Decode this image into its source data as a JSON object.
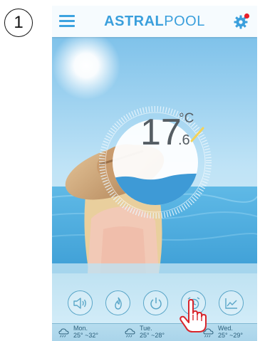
{
  "step_marker": "1",
  "app": {
    "brand_part1": "ASTRAL",
    "brand_part2": "POOL",
    "menu_icon": "hamburger-menu-icon",
    "settings_icon": "gear-icon",
    "notification_color": "#e8202a",
    "accent_color": "#3da3e0"
  },
  "temperature": {
    "integer": "17",
    "unit": "°C",
    "decimal": ".6"
  },
  "controls": [
    {
      "name": "sound-icon"
    },
    {
      "name": "flame-icon"
    },
    {
      "name": "power-icon"
    },
    {
      "name": "alarm-clock-icon"
    },
    {
      "name": "chart-icon"
    }
  ],
  "forecast": [
    {
      "day": "Mon.",
      "range": "25° ~32°",
      "icon": "cloud-sun-icon"
    },
    {
      "day": "Tue.",
      "range": "25° ~28°",
      "icon": "cloud-sun-icon"
    },
    {
      "day": "Wed.",
      "range": "25° ~29°",
      "icon": "cloud-sun-icon"
    }
  ]
}
